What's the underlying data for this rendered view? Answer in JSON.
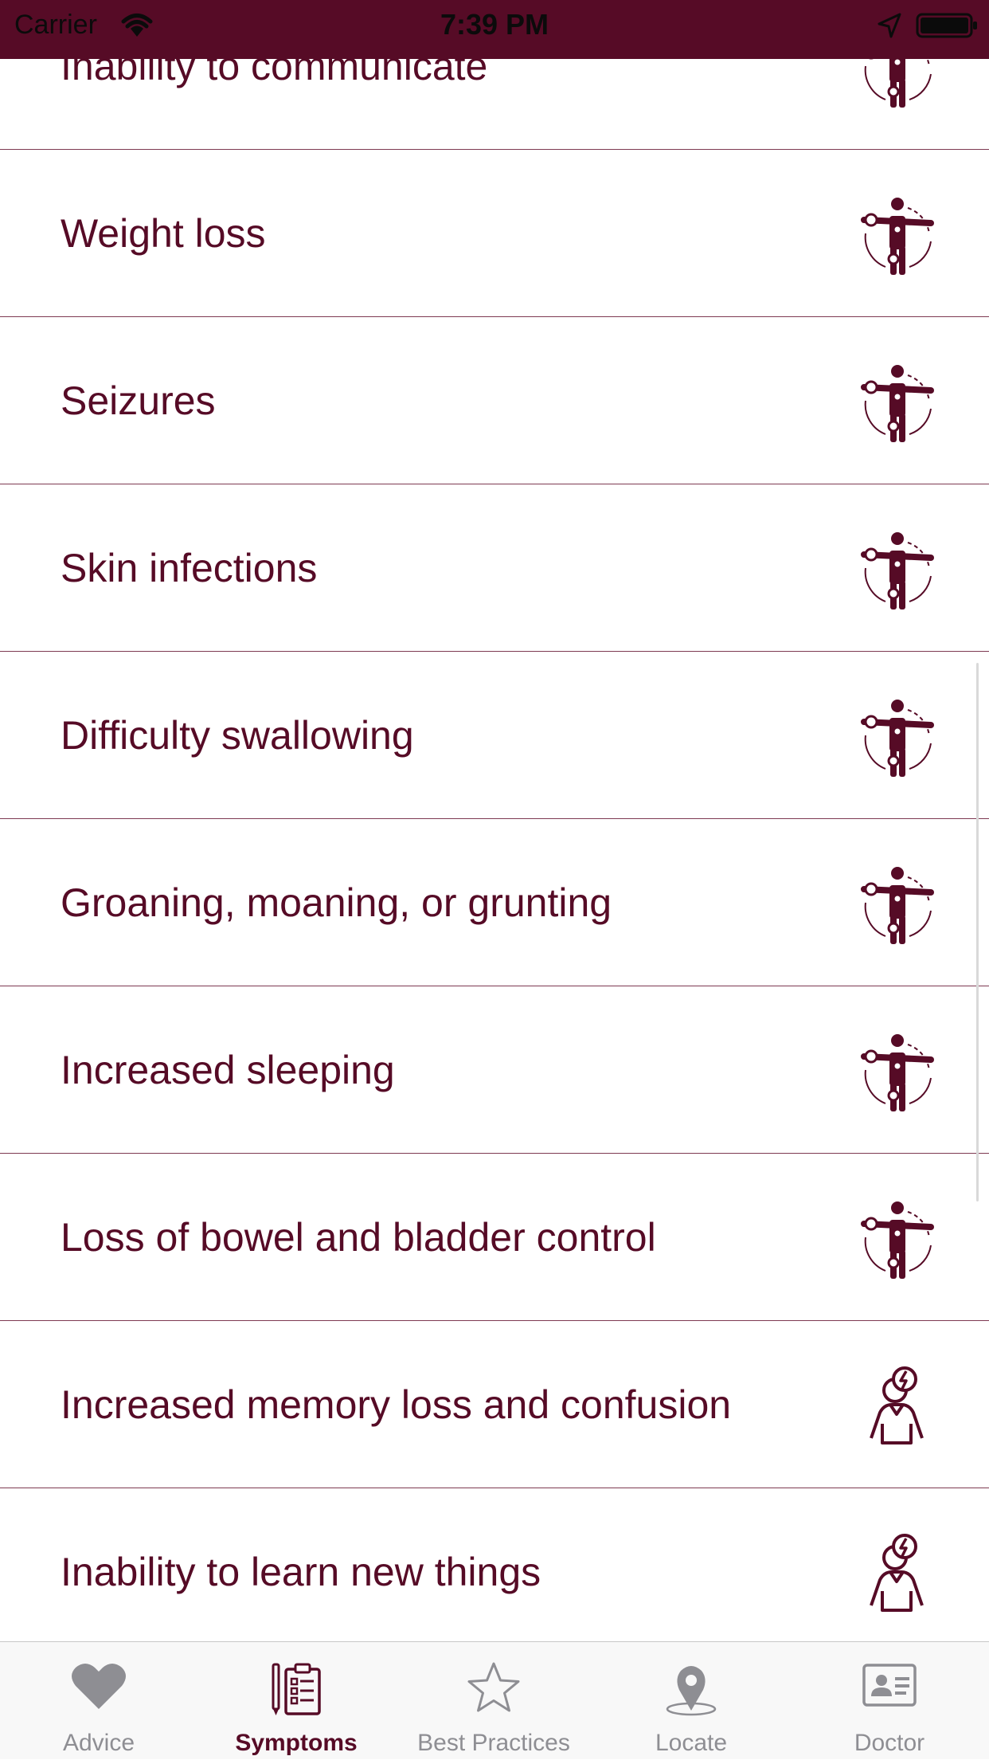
{
  "status_bar": {
    "carrier": "Carrier",
    "time": "7:39 PM"
  },
  "symptoms": [
    {
      "label": "Inability to communicate",
      "icon": "body-pain-icon"
    },
    {
      "label": "Weight loss",
      "icon": "body-pain-icon"
    },
    {
      "label": "Seizures",
      "icon": "body-pain-icon"
    },
    {
      "label": "Skin infections",
      "icon": "body-pain-icon"
    },
    {
      "label": "Difficulty swallowing",
      "icon": "body-pain-icon"
    },
    {
      "label": "Groaning, moaning, or grunting",
      "icon": "body-pain-icon"
    },
    {
      "label": "Increased sleeping",
      "icon": "body-pain-icon"
    },
    {
      "label": "Loss of bowel and bladder control",
      "icon": "body-pain-icon"
    },
    {
      "label": "Increased memory loss and confusion",
      "icon": "mind-person-icon"
    },
    {
      "label": "Inability to learn new things",
      "icon": "mind-person-icon"
    }
  ],
  "tabs": [
    {
      "label": "Advice",
      "icon": "heart-icon",
      "active": false
    },
    {
      "label": "Symptoms",
      "icon": "clipboard-icon",
      "active": true
    },
    {
      "label": "Best Practices",
      "icon": "star-icon",
      "active": false
    },
    {
      "label": "Locate",
      "icon": "map-pin-icon",
      "active": false
    },
    {
      "label": "Doctor",
      "icon": "id-card-icon",
      "active": false
    }
  ],
  "colors": {
    "brand": "#560b26",
    "tab_inactive": "#8e8e93",
    "separator": "#7e3a52"
  }
}
